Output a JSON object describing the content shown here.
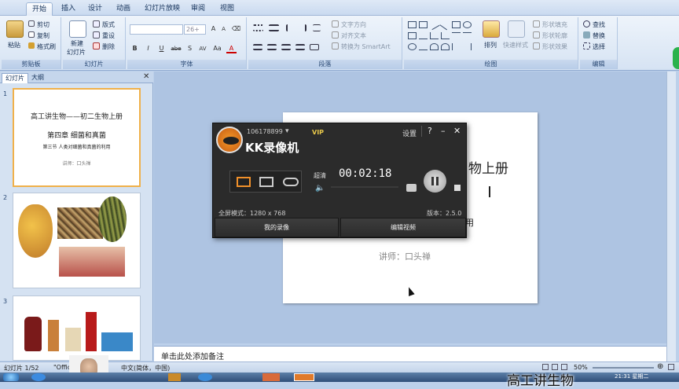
{
  "ribbon_tabs": [
    "开始",
    "插入",
    "设计",
    "动画",
    "幻灯片放映",
    "审阅",
    "视图"
  ],
  "clipboard": {
    "paste": "粘贴",
    "cut": "剪切",
    "copy": "复制",
    "format_painter": "格式刷",
    "label": "剪贴板"
  },
  "slides_group": {
    "new_slide_line1": "新建",
    "new_slide_line2": "幻灯片",
    "layout": "版式",
    "reset": "重设",
    "delete": "删除",
    "label": "幻灯片"
  },
  "font_group": {
    "font_size": "26+",
    "label": "字体",
    "format_buttons": [
      "B",
      "I",
      "U",
      "abe",
      "S",
      "AV",
      "Aa",
      "A"
    ]
  },
  "paragraph_group": {
    "text_direction": "文字方向",
    "align_text": "对齐文本",
    "convert_smartart": "转换为 SmartArt",
    "label": "段落"
  },
  "drawing_group": {
    "arrange": "排列",
    "quick_styles": "快速样式",
    "shape_fill": "形状填充",
    "shape_outline": "形状轮廓",
    "shape_effects": "形状效果",
    "label": "绘图"
  },
  "editing_group": {
    "find": "查找",
    "replace": "替换",
    "select": "选择",
    "label": "编辑"
  },
  "panel_tabs": {
    "slides": "幻灯片",
    "outline": "大纲"
  },
  "thumbnails": [
    {
      "num": "1",
      "title": "高工讲生物——初二生物上册",
      "subtitle": "第四章 细菌和真菌",
      "line3": "第三节 人类对细菌和真菌的利用",
      "lecturer": "讲师：口头禅"
    },
    {
      "num": "2"
    },
    {
      "num": "3"
    }
  ],
  "slide": {
    "line1_partial": "物上册",
    "line3_partial": "用",
    "lecturer": "讲师：口头禅"
  },
  "notes_placeholder": "单击此处添加备注",
  "status": {
    "slide_count": "幻灯片 1/52",
    "theme": "\"Offic",
    "language": "中文(简体，中国)",
    "zoom": "50%",
    "clock": "21:31 星期二"
  },
  "kk": {
    "account": "106178899",
    "vip": "VIP",
    "app_name": "KK录像机",
    "settings": "设置",
    "help": "?",
    "minimize": "–",
    "close": "✕",
    "quality": "超清",
    "timer": "00:02:18",
    "mode_label": "全屏模式：1280 x 768",
    "version": "版本：2.5.0",
    "my_recordings": "我的录像",
    "edit_video": "编辑视频"
  },
  "watermark": "高工讲生物"
}
